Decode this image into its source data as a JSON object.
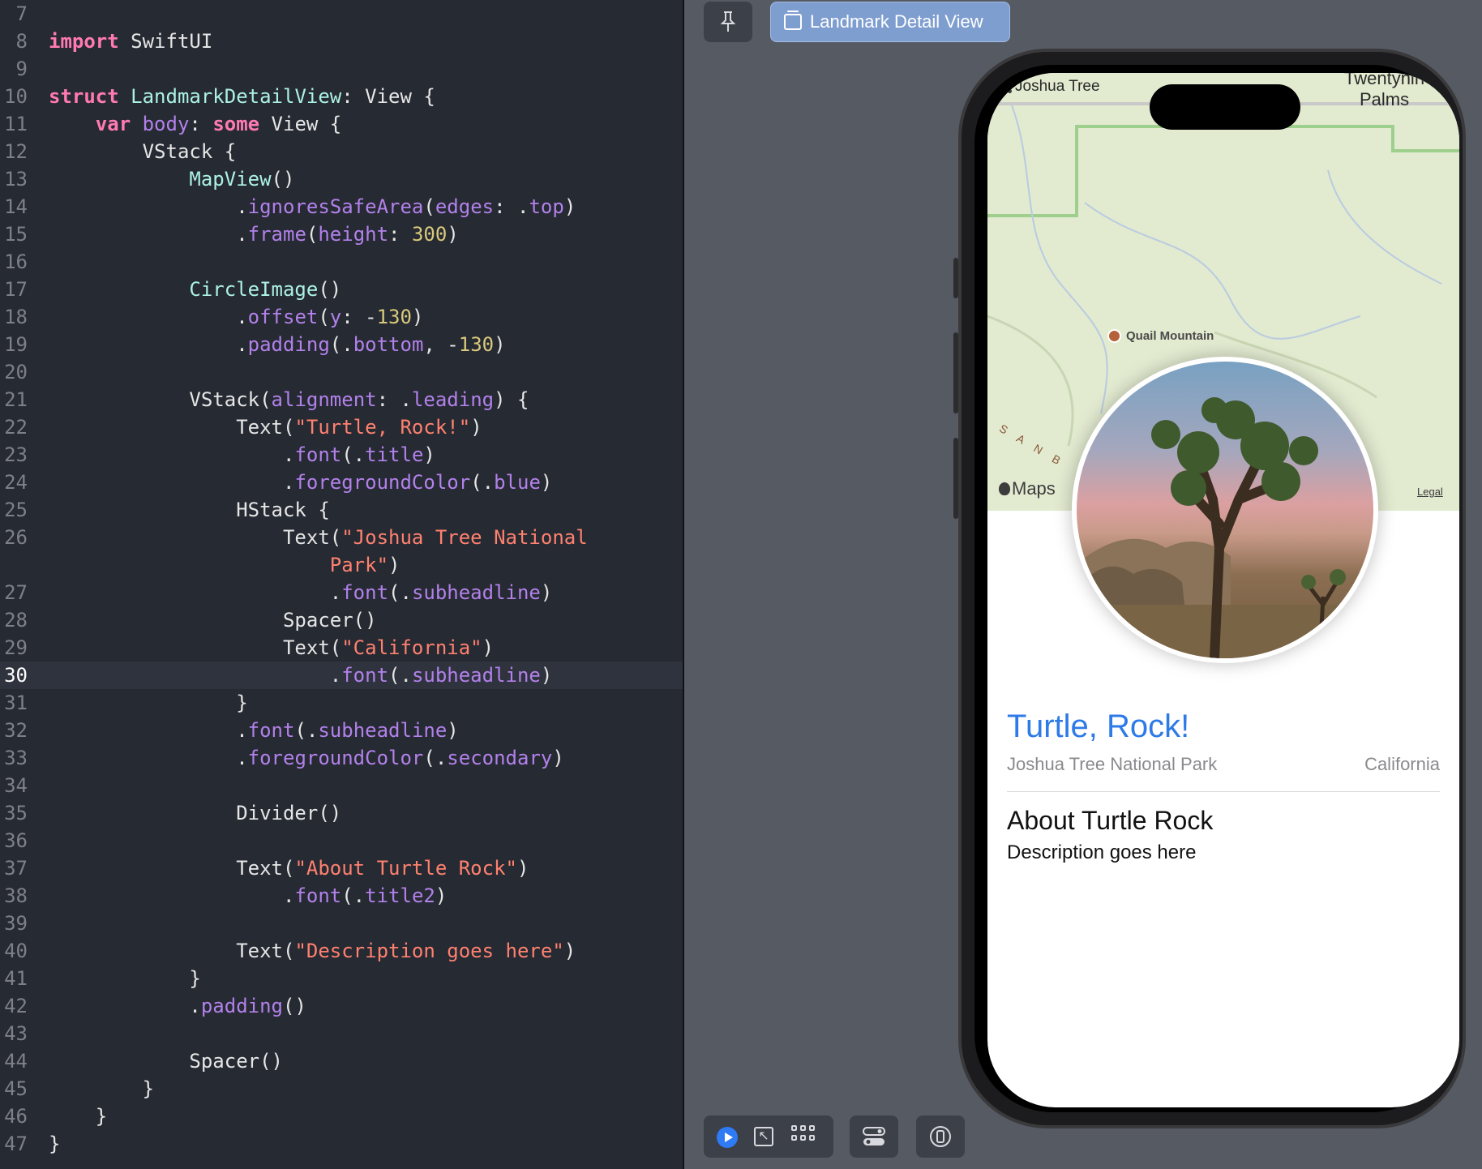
{
  "editor": {
    "current_line": "30",
    "lines": [
      {
        "num": "7",
        "tokens": []
      },
      {
        "num": "8",
        "tokens": [
          {
            "t": "import",
            "c": "kw"
          },
          {
            "t": " SwiftUI",
            "c": "pl"
          }
        ]
      },
      {
        "num": "9",
        "tokens": []
      },
      {
        "num": "10",
        "tokens": [
          {
            "t": "struct",
            "c": "kw"
          },
          {
            "t": " ",
            "c": "pl"
          },
          {
            "t": "LandmarkDetailView",
            "c": "type"
          },
          {
            "t": ": ",
            "c": "pl"
          },
          {
            "t": "View",
            "c": "pl"
          },
          {
            "t": " {",
            "c": "pl"
          }
        ]
      },
      {
        "num": "11",
        "tokens": [
          {
            "t": "    ",
            "c": "pl"
          },
          {
            "t": "var",
            "c": "kw"
          },
          {
            "t": " ",
            "c": "pl"
          },
          {
            "t": "body",
            "c": "call"
          },
          {
            "t": ": ",
            "c": "pl"
          },
          {
            "t": "some",
            "c": "kw"
          },
          {
            "t": " View {",
            "c": "pl"
          }
        ]
      },
      {
        "num": "12",
        "tokens": [
          {
            "t": "        VStack {",
            "c": "pl"
          }
        ]
      },
      {
        "num": "13",
        "tokens": [
          {
            "t": "            ",
            "c": "pl"
          },
          {
            "t": "MapView",
            "c": "type"
          },
          {
            "t": "()",
            "c": "pl"
          }
        ]
      },
      {
        "num": "14",
        "tokens": [
          {
            "t": "                .",
            "c": "pl"
          },
          {
            "t": "ignoresSafeArea",
            "c": "call"
          },
          {
            "t": "(",
            "c": "pl"
          },
          {
            "t": "edges",
            "c": "call"
          },
          {
            "t": ": .",
            "c": "pl"
          },
          {
            "t": "top",
            "c": "call"
          },
          {
            "t": ")",
            "c": "pl"
          }
        ]
      },
      {
        "num": "15",
        "tokens": [
          {
            "t": "                .",
            "c": "pl"
          },
          {
            "t": "frame",
            "c": "call"
          },
          {
            "t": "(",
            "c": "pl"
          },
          {
            "t": "height",
            "c": "call"
          },
          {
            "t": ": ",
            "c": "pl"
          },
          {
            "t": "300",
            "c": "num"
          },
          {
            "t": ")",
            "c": "pl"
          }
        ]
      },
      {
        "num": "16",
        "tokens": []
      },
      {
        "num": "17",
        "tokens": [
          {
            "t": "            ",
            "c": "pl"
          },
          {
            "t": "CircleImage",
            "c": "type"
          },
          {
            "t": "()",
            "c": "pl"
          }
        ]
      },
      {
        "num": "18",
        "tokens": [
          {
            "t": "                .",
            "c": "pl"
          },
          {
            "t": "offset",
            "c": "call"
          },
          {
            "t": "(",
            "c": "pl"
          },
          {
            "t": "y",
            "c": "call"
          },
          {
            "t": ": -",
            "c": "pl"
          },
          {
            "t": "130",
            "c": "num"
          },
          {
            "t": ")",
            "c": "pl"
          }
        ]
      },
      {
        "num": "19",
        "tokens": [
          {
            "t": "                .",
            "c": "pl"
          },
          {
            "t": "padding",
            "c": "call"
          },
          {
            "t": "(.",
            "c": "pl"
          },
          {
            "t": "bottom",
            "c": "call"
          },
          {
            "t": ", -",
            "c": "pl"
          },
          {
            "t": "130",
            "c": "num"
          },
          {
            "t": ")",
            "c": "pl"
          }
        ]
      },
      {
        "num": "20",
        "tokens": []
      },
      {
        "num": "21",
        "tokens": [
          {
            "t": "            VStack(",
            "c": "pl"
          },
          {
            "t": "alignment",
            "c": "call"
          },
          {
            "t": ": .",
            "c": "pl"
          },
          {
            "t": "leading",
            "c": "call"
          },
          {
            "t": ") {",
            "c": "pl"
          }
        ]
      },
      {
        "num": "22",
        "tokens": [
          {
            "t": "                Text(",
            "c": "pl"
          },
          {
            "t": "\"Turtle, Rock!\"",
            "c": "str"
          },
          {
            "t": ")",
            "c": "pl"
          }
        ]
      },
      {
        "num": "23",
        "tokens": [
          {
            "t": "                    .",
            "c": "pl"
          },
          {
            "t": "font",
            "c": "call"
          },
          {
            "t": "(.",
            "c": "pl"
          },
          {
            "t": "title",
            "c": "call"
          },
          {
            "t": ")",
            "c": "pl"
          }
        ]
      },
      {
        "num": "24",
        "tokens": [
          {
            "t": "                    .",
            "c": "pl"
          },
          {
            "t": "foregroundColor",
            "c": "call"
          },
          {
            "t": "(.",
            "c": "pl"
          },
          {
            "t": "blue",
            "c": "call"
          },
          {
            "t": ")",
            "c": "pl"
          }
        ]
      },
      {
        "num": "25",
        "tokens": [
          {
            "t": "                HStack {",
            "c": "pl"
          }
        ]
      },
      {
        "num": "26",
        "tokens": [
          {
            "t": "                    Text(",
            "c": "pl"
          },
          {
            "t": "\"Joshua Tree National",
            "c": "str"
          }
        ]
      },
      {
        "num": "",
        "tokens": [
          {
            "t": "                        ",
            "c": "pl"
          },
          {
            "t": "Park\"",
            "c": "str"
          },
          {
            "t": ")",
            "c": "pl"
          }
        ]
      },
      {
        "num": "27",
        "tokens": [
          {
            "t": "                        .",
            "c": "pl"
          },
          {
            "t": "font",
            "c": "call"
          },
          {
            "t": "(.",
            "c": "pl"
          },
          {
            "t": "subheadline",
            "c": "call"
          },
          {
            "t": ")",
            "c": "pl"
          }
        ]
      },
      {
        "num": "28",
        "tokens": [
          {
            "t": "                    Spacer()",
            "c": "pl"
          }
        ]
      },
      {
        "num": "29",
        "tokens": [
          {
            "t": "                    Text(",
            "c": "pl"
          },
          {
            "t": "\"California\"",
            "c": "str"
          },
          {
            "t": ")",
            "c": "pl"
          }
        ]
      },
      {
        "num": "30",
        "tokens": [
          {
            "t": "                        .",
            "c": "pl"
          },
          {
            "t": "font",
            "c": "call"
          },
          {
            "t": "(.",
            "c": "pl"
          },
          {
            "t": "subheadline",
            "c": "call"
          },
          {
            "t": ")",
            "c": "pl"
          }
        ]
      },
      {
        "num": "31",
        "tokens": [
          {
            "t": "                }",
            "c": "pl"
          }
        ]
      },
      {
        "num": "32",
        "tokens": [
          {
            "t": "                .",
            "c": "pl"
          },
          {
            "t": "font",
            "c": "call"
          },
          {
            "t": "(.",
            "c": "pl"
          },
          {
            "t": "subheadline",
            "c": "call"
          },
          {
            "t": ")",
            "c": "pl"
          }
        ]
      },
      {
        "num": "33",
        "tokens": [
          {
            "t": "                .",
            "c": "pl"
          },
          {
            "t": "foregroundColor",
            "c": "call"
          },
          {
            "t": "(.",
            "c": "pl"
          },
          {
            "t": "secondary",
            "c": "call"
          },
          {
            "t": ")",
            "c": "pl"
          }
        ]
      },
      {
        "num": "34",
        "tokens": []
      },
      {
        "num": "35",
        "tokens": [
          {
            "t": "                Divider()",
            "c": "pl"
          }
        ]
      },
      {
        "num": "36",
        "tokens": []
      },
      {
        "num": "37",
        "tokens": [
          {
            "t": "                Text(",
            "c": "pl"
          },
          {
            "t": "\"About Turtle Rock\"",
            "c": "str"
          },
          {
            "t": ")",
            "c": "pl"
          }
        ]
      },
      {
        "num": "38",
        "tokens": [
          {
            "t": "                    .",
            "c": "pl"
          },
          {
            "t": "font",
            "c": "call"
          },
          {
            "t": "(.",
            "c": "pl"
          },
          {
            "t": "title2",
            "c": "call"
          },
          {
            "t": ")",
            "c": "pl"
          }
        ]
      },
      {
        "num": "39",
        "tokens": []
      },
      {
        "num": "40",
        "tokens": [
          {
            "t": "                Text(",
            "c": "pl"
          },
          {
            "t": "\"Description goes here\"",
            "c": "str"
          },
          {
            "t": ")",
            "c": "pl"
          }
        ]
      },
      {
        "num": "41",
        "tokens": [
          {
            "t": "            }",
            "c": "pl"
          }
        ]
      },
      {
        "num": "42",
        "tokens": [
          {
            "t": "            .",
            "c": "pl"
          },
          {
            "t": "padding",
            "c": "call"
          },
          {
            "t": "()",
            "c": "pl"
          }
        ]
      },
      {
        "num": "43",
        "tokens": []
      },
      {
        "num": "44",
        "tokens": [
          {
            "t": "            Spacer()",
            "c": "pl"
          }
        ]
      },
      {
        "num": "45",
        "tokens": [
          {
            "t": "        }",
            "c": "pl"
          }
        ]
      },
      {
        "num": "46",
        "tokens": [
          {
            "t": "    }",
            "c": "pl"
          }
        ]
      },
      {
        "num": "47",
        "tokens": [
          {
            "t": "}",
            "c": "pl"
          }
        ]
      }
    ]
  },
  "canvas": {
    "tab_label": "Landmark Detail View",
    "pin_icon": "pin-icon",
    "bottom_icons": [
      "live-preview-icon",
      "selectable-icon",
      "variants-icon",
      "device-settings-icon",
      "device-icon"
    ]
  },
  "preview": {
    "map_labels": {
      "town1": "Joshua Tree",
      "town2_line1": "Twentynin",
      "town2_line2": "Palms",
      "poi": "Quail Mountain",
      "range": "S A N B",
      "maps_logo": "Maps",
      "legal": "Legal"
    },
    "title": "Turtle, Rock!",
    "park": "Joshua Tree National Park",
    "state": "California",
    "about_heading": "About Turtle Rock",
    "description": "Description goes here",
    "title_color": "#2e7ae6"
  }
}
